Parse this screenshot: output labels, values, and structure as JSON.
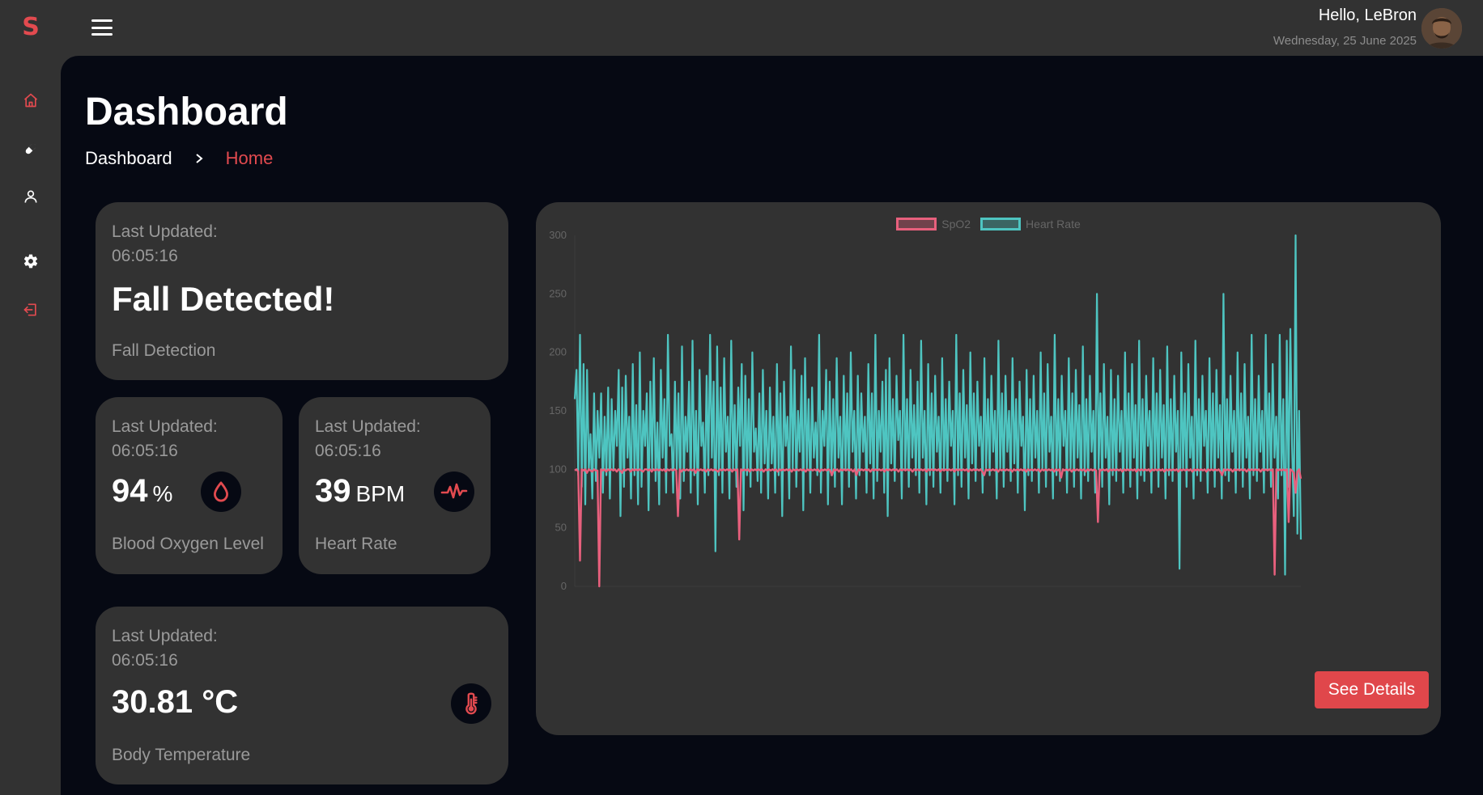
{
  "app": {
    "logo": "S"
  },
  "sidebar": {
    "items": [
      {
        "name": "home-icon",
        "active": true
      },
      {
        "name": "pill-icon",
        "active": false
      },
      {
        "name": "user-icon",
        "active": false
      },
      {
        "name": "gear-icon",
        "active": false
      },
      {
        "name": "logout-icon",
        "active": true
      }
    ]
  },
  "header": {
    "greeting": "Hello, LeBron",
    "date": "Wednesday, 25 June 2025"
  },
  "page": {
    "title": "Dashboard",
    "breadcrumb": [
      "Dashboard",
      "Home"
    ]
  },
  "cards": {
    "fall": {
      "updated_label": "Last Updated:",
      "updated_time": "06:05:16",
      "value": "Fall Detected!",
      "label": "Fall Detection"
    },
    "oxygen": {
      "updated_label": "Last Updated:",
      "updated_time": "06:05:16",
      "value": "94",
      "unit": "%",
      "label": "Blood Oxygen Level",
      "icon": "droplet-icon"
    },
    "heart": {
      "updated_label": "Last Updated:",
      "updated_time": "06:05:16",
      "value": "39",
      "unit": "BPM",
      "label": "Heart Rate",
      "icon": "heartbeat-icon"
    },
    "temp": {
      "updated_label": "Last Updated:",
      "updated_time": "06:05:16",
      "value": "30.81 °C",
      "label": "Body Temperature",
      "icon": "thermometer-icon"
    }
  },
  "colors": {
    "accent": "#e24a4f",
    "spo2": "#e8607d",
    "heart_rate": "#4ec5c1",
    "panel": "#323232",
    "background": "#060913"
  },
  "chart_data": {
    "type": "line",
    "title": "",
    "xlabel": "",
    "ylabel": "",
    "ylim": [
      0,
      300
    ],
    "yticks": [
      0,
      50,
      100,
      150,
      200,
      250,
      300
    ],
    "legend_position": "top",
    "grid": false,
    "series": [
      {
        "name": "SpO2",
        "color": "#e8607d",
        "values": [
          99,
          100,
          98,
          22,
          100,
          99,
          100,
          97,
          100,
          99,
          98,
          100,
          99,
          99,
          0,
          100,
          99,
          100,
          98,
          100,
          99,
          100,
          99,
          100,
          98,
          100,
          99,
          97,
          100,
          99,
          100,
          100,
          98,
          100,
          99,
          100,
          99,
          100,
          99,
          98,
          100,
          100,
          99,
          100,
          98,
          100,
          99,
          100,
          99,
          100,
          99,
          100,
          98,
          100,
          99,
          100,
          99,
          100,
          99,
          60,
          100,
          98,
          100,
          99,
          100,
          99,
          100,
          99,
          100,
          97,
          100,
          99,
          100,
          99,
          100,
          98,
          100,
          99,
          100,
          99,
          100,
          99,
          98,
          100,
          99,
          100,
          99,
          100,
          99,
          100,
          98,
          100,
          99,
          100,
          40,
          100,
          99,
          100,
          99,
          100,
          98,
          100,
          99,
          100,
          99,
          100,
          99,
          100,
          98,
          100,
          99,
          100,
          99,
          100,
          99,
          100,
          98,
          100,
          99,
          100,
          99,
          100,
          99,
          100,
          98,
          100,
          99,
          100,
          99,
          100,
          99,
          100,
          98,
          100,
          99,
          100,
          99,
          100,
          99,
          100,
          98,
          100,
          99,
          100,
          99,
          100,
          99,
          95,
          100,
          99,
          100,
          98,
          100,
          99,
          100,
          99,
          100,
          99,
          100,
          98,
          100,
          95,
          100,
          99,
          100,
          99,
          100,
          99,
          100,
          98,
          100,
          99,
          100,
          99,
          100,
          99,
          100,
          98,
          100,
          99,
          100,
          99,
          100,
          99,
          100,
          98,
          100,
          99,
          100,
          99,
          100,
          99,
          100,
          98,
          100,
          99,
          100,
          99,
          100,
          99,
          100,
          98,
          100,
          99,
          100,
          99,
          100,
          99,
          100,
          98,
          100,
          99,
          100,
          99,
          100,
          99,
          100,
          98,
          100,
          99,
          100,
          99,
          100,
          99,
          100,
          98,
          100,
          99,
          100,
          99,
          100,
          99,
          100,
          98,
          95,
          100,
          99,
          100,
          99,
          100,
          99,
          100,
          98,
          100,
          99,
          100,
          99,
          100,
          99,
          100,
          98,
          100,
          99,
          100,
          99,
          100,
          99,
          100,
          98,
          100,
          99,
          100,
          99,
          100,
          99,
          100,
          98,
          100,
          99,
          100,
          99,
          100,
          99,
          100,
          98,
          100,
          99,
          100,
          93,
          100,
          99,
          100,
          99,
          100,
          98,
          100,
          99,
          100,
          99,
          100,
          99,
          100,
          98,
          100,
          99,
          100,
          99,
          100,
          99,
          55,
          100,
          99,
          100,
          99,
          100,
          98,
          100,
          99,
          100,
          99,
          100,
          99,
          100,
          98,
          100,
          99,
          100,
          99,
          100,
          99,
          100,
          98,
          100,
          99,
          100,
          99,
          100,
          99,
          100,
          98,
          100,
          99,
          100,
          99,
          100,
          99,
          100,
          98,
          100,
          99,
          100,
          99,
          100,
          99,
          100,
          98,
          100,
          99,
          100,
          99,
          100,
          99,
          100,
          98,
          100,
          99,
          100,
          99,
          100,
          99,
          100,
          98,
          100,
          99,
          100,
          99,
          100,
          99,
          100,
          98,
          95,
          100,
          99,
          100,
          99,
          100,
          98,
          100,
          99,
          100,
          99,
          100,
          99,
          100,
          98,
          100,
          99,
          100,
          99,
          100,
          99,
          100,
          98,
          100,
          99,
          100,
          99,
          100,
          99,
          100,
          10,
          100,
          99,
          100,
          99,
          100,
          99,
          100,
          55,
          100,
          99,
          97,
          80,
          98,
          100,
          92
        ]
      },
      {
        "name": "Heart Rate",
        "color": "#4ec5c1",
        "values": [
          160,
          185,
          95,
          215,
          85,
          190,
          70,
          185,
          100,
          130,
          75,
          165,
          90,
          150,
          110,
          165,
          80,
          145,
          95,
          170,
          75,
          160,
          100,
          150,
          120,
          185,
          60,
          170,
          85,
          180,
          110,
          145,
          75,
          190,
          95,
          155,
          70,
          200,
          85,
          150,
          120,
          165,
          65,
          175,
          100,
          195,
          90,
          140,
          70,
          185,
          110,
          160,
          80,
          215,
          120,
          130,
          80,
          175,
          100,
          165,
          75,
          205,
          90,
          145,
          115,
          175,
          80,
          210,
          95,
          150,
          70,
          185,
          120,
          140,
          80,
          180,
          95,
          215,
          110,
          175,
          30,
          205,
          95,
          170,
          80,
          195,
          115,
          145,
          75,
          210,
          100,
          155,
          85,
          170,
          120,
          190,
          65,
          180,
          95,
          160,
          85,
          200,
          115,
          135,
          90,
          165,
          80,
          185,
          105,
          150,
          75,
          170,
          105,
          145,
          80,
          190,
          95,
          165,
          60,
          175,
          120,
          145,
          75,
          205,
          100,
          185,
          85,
          150,
          115,
          180,
          65,
          195,
          100,
          160,
          80,
          170,
          110,
          140,
          95,
          215,
          80,
          150,
          120,
          185,
          70,
          175,
          95,
          160,
          85,
          195,
          110,
          145,
          70,
          180,
          100,
          165,
          85,
          200,
          115,
          150,
          75,
          180,
          95,
          165,
          115,
          145,
          80,
          190,
          105,
          165,
          75,
          215,
          90,
          150,
          115,
          175,
          80,
          185,
          60,
          195,
          105,
          160,
          90,
          180,
          125,
          150,
          75,
          215,
          100,
          160,
          85,
          185,
          110,
          155,
          95,
          175,
          80,
          210,
          110,
          150,
          70,
          190,
          95,
          165,
          85,
          180,
          115,
          145,
          80,
          195,
          100,
          160,
          90,
          175,
          120,
          150,
          70,
          215,
          95,
          165,
          85,
          185,
          110,
          155,
          75,
          200,
          105,
          165,
          90,
          175,
          120,
          145,
          80,
          195,
          100,
          160,
          95,
          180,
          115,
          150,
          75,
          210,
          100,
          165,
          85,
          180,
          115,
          150,
          90,
          195,
          105,
          160,
          80,
          175,
          120,
          145,
          65,
          185,
          95,
          160,
          90,
          180,
          110,
          150,
          80,
          200,
          100,
          165,
          85,
          190,
          115,
          145,
          75,
          215,
          95,
          160,
          90,
          180,
          120,
          150,
          80,
          195,
          100,
          165,
          85,
          185,
          110,
          155,
          75,
          205,
          95,
          160,
          90,
          180,
          115,
          150,
          80,
          250,
          100,
          165,
          85,
          190,
          110,
          145,
          70,
          185,
          95,
          160,
          90,
          180,
          115,
          150,
          80,
          200,
          100,
          165,
          85,
          190,
          110,
          155,
          75,
          210,
          95,
          160,
          90,
          180,
          120,
          150,
          80,
          195,
          100,
          165,
          85,
          185,
          110,
          155,
          75,
          205,
          95,
          160,
          90,
          180,
          115,
          150,
          15,
          200,
          100,
          165,
          85,
          190,
          110,
          145,
          75,
          210,
          95,
          160,
          90,
          180,
          120,
          150,
          80,
          195,
          100,
          165,
          85,
          185,
          110,
          155,
          75,
          250,
          95,
          160,
          90,
          180,
          115,
          150,
          80,
          200,
          100,
          165,
          85,
          190,
          110,
          145,
          75,
          215,
          95,
          160,
          90,
          180,
          115,
          150,
          80,
          215,
          100,
          165,
          85,
          190,
          110,
          145,
          75,
          215,
          95,
          160,
          10,
          210,
          85,
          220,
          120,
          60,
          300,
          45,
          150,
          40
        ]
      }
    ]
  },
  "actions": {
    "see_details": "See Details"
  }
}
